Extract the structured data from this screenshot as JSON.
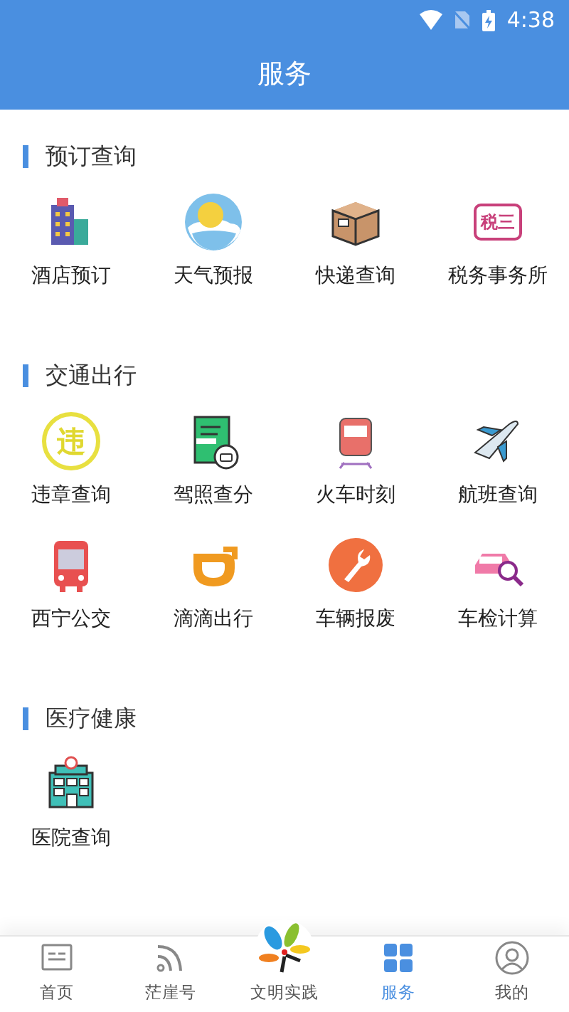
{
  "status_bar": {
    "time": "4:38"
  },
  "header": {
    "title": "服务"
  },
  "sections": [
    {
      "title": "预订查询",
      "items": [
        {
          "label": "酒店预订"
        },
        {
          "label": "天气预报"
        },
        {
          "label": "快递查询"
        },
        {
          "label": "税务事务所",
          "icon_text": "税三"
        }
      ]
    },
    {
      "title": "交通出行",
      "items": [
        {
          "label": "违章查询",
          "icon_text": "违"
        },
        {
          "label": "驾照查分"
        },
        {
          "label": "火车时刻"
        },
        {
          "label": "航班查询"
        },
        {
          "label": "西宁公交"
        },
        {
          "label": "滴滴出行"
        },
        {
          "label": "车辆报废"
        },
        {
          "label": "车检计算"
        }
      ]
    },
    {
      "title": "医疗健康",
      "items": [
        {
          "label": "医院查询"
        }
      ]
    }
  ],
  "bottom_nav": [
    {
      "label": "首页",
      "selected": false
    },
    {
      "label": "茫崖号",
      "selected": false
    },
    {
      "label": "文明实践",
      "selected": false
    },
    {
      "label": "服务",
      "selected": true
    },
    {
      "label": "我的",
      "selected": false
    }
  ]
}
